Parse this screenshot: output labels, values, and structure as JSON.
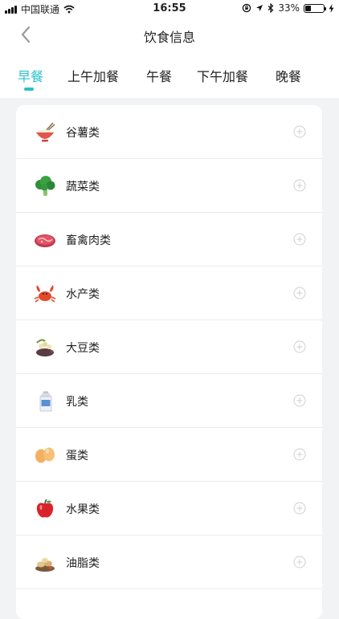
{
  "status_bar": {
    "carrier": "中国联通",
    "time": "16:55",
    "battery_percent": "33%",
    "battery_level": 0.33
  },
  "header": {
    "title": "饮食信息"
  },
  "tabs": [
    {
      "label": "早餐",
      "active": true
    },
    {
      "label": "上午加餐",
      "active": false
    },
    {
      "label": "午餐",
      "active": false
    },
    {
      "label": "下午加餐",
      "active": false
    },
    {
      "label": "晚餐",
      "active": false
    }
  ],
  "food_categories": [
    {
      "label": "谷薯类",
      "icon": "rice-bowl-icon"
    },
    {
      "label": "蔬菜类",
      "icon": "broccoli-icon"
    },
    {
      "label": "畜禽肉类",
      "icon": "meat-icon"
    },
    {
      "label": "水产类",
      "icon": "crab-icon"
    },
    {
      "label": "大豆类",
      "icon": "beans-icon"
    },
    {
      "label": "乳类",
      "icon": "milk-carton-icon"
    },
    {
      "label": "蛋类",
      "icon": "eggs-icon"
    },
    {
      "label": "水果类",
      "icon": "apple-icon"
    },
    {
      "label": "油脂类",
      "icon": "nuts-icon"
    }
  ],
  "colors": {
    "accent": "#29c0cc",
    "background": "#f2f3f5",
    "divider": "#ececec"
  }
}
